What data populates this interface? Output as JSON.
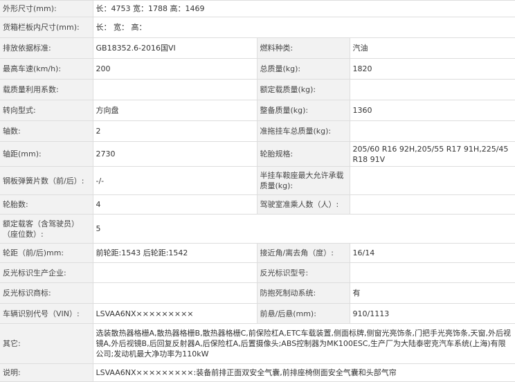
{
  "rows": [
    {
      "l1": "外形尺寸(mm):",
      "v1": "长：4753 宽：1788 高：1469",
      "full": true
    },
    {
      "l1": "货箱栏板内尺寸(mm):",
      "v1": "长： 宽： 高：",
      "full": true
    },
    {
      "l1": "排放依据标准:",
      "v1": "GB18352.6-2016国VI",
      "l2": "燃料种类:",
      "v2": "汽油"
    },
    {
      "l1": "最高车速(km/h):",
      "v1": "200",
      "l2": "总质量(kg):",
      "v2": "1820"
    },
    {
      "l1": "载质量利用系数:",
      "v1": "",
      "l2": "额定载质量(kg):",
      "v2": ""
    },
    {
      "l1": "转向型式:",
      "v1": "方向盘",
      "l2": "整备质量(kg):",
      "v2": "1360"
    },
    {
      "l1": "轴数:",
      "v1": "2",
      "l2": "准拖挂车总质量(kg):",
      "v2": ""
    },
    {
      "l1": "轴距(mm):",
      "v1": "2730",
      "l2": "轮胎规格:",
      "v2": "205/60 R16 92H,205/55 R17 91H,225/45 R18 91V"
    },
    {
      "l1": "钢板弹簧片数（前/后）:",
      "v1": "-/-",
      "l2": "半挂车鞍座最大允许承载质量(kg):",
      "v2": ""
    },
    {
      "l1": "轮胎数:",
      "v1": "4",
      "l2": "驾驶室准乘人数（人）:",
      "v2": ""
    },
    {
      "l1": "额定载客（含驾驶员）（座位数）:",
      "v1": "5",
      "full": true
    },
    {
      "l1": "轮距（前/后)mm:",
      "v1": "前轮距:1543 后轮距:1542",
      "l2": "接近角/离去角（度）:",
      "v2": "16/14"
    },
    {
      "l1": "反光标识生产企业:",
      "v1": "",
      "l2": "反光标识型号:",
      "v2": ""
    },
    {
      "l1": "反光标识商标:",
      "v1": "",
      "l2": "防抱死制动系统:",
      "v2": "有"
    },
    {
      "l1": "车辆识别代号（VIN）:",
      "v1": "LSVAA6NX×××××××××",
      "l2": "前悬/后悬(mm):",
      "v2": "910/1113"
    },
    {
      "l1": "其它:",
      "v1": "选装散热器格栅A,散热器格栅B,散热器格栅C,前保险杠A,ETC车载装置,侧面标牌,侧窗光亮饰条,门把手光亮饰条,天窗,外后视镜A,外后视镜B,后回复反射器A,后保险杠A,后置摄像头;ABS控制器为MK100ESC,生产厂为大陆泰密克汽车系统(上海)有限公司;发动机最大净功率为110kW",
      "full": true
    },
    {
      "l1": "说明:",
      "v1": "LSVAA6NX×××××××××:装备前排正面双安全气囊,前排座椅侧面安全气囊和头部气帘",
      "full": true
    }
  ]
}
